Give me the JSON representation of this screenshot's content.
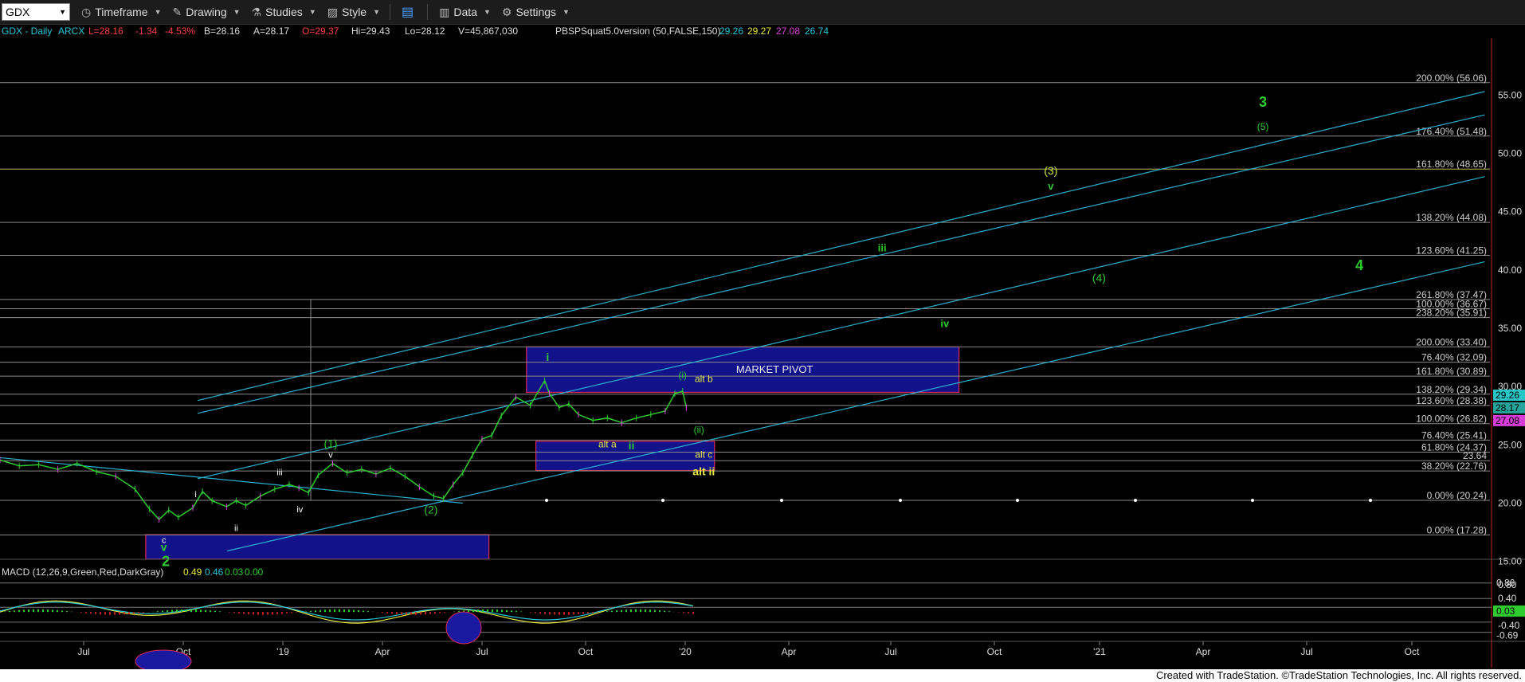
{
  "toolbar": {
    "symbol": "GDX",
    "items": [
      {
        "name": "timeframe",
        "label": "Timeframe",
        "icon": "clock-icon"
      },
      {
        "name": "drawing",
        "label": "Drawing",
        "icon": "pencil-icon"
      },
      {
        "name": "studies",
        "label": "Studies",
        "icon": "flask-icon"
      },
      {
        "name": "style",
        "label": "Style",
        "icon": "style-icon"
      },
      {
        "name": "data",
        "label": "Data",
        "icon": "bar-chart-icon"
      },
      {
        "name": "settings",
        "label": "Settings",
        "icon": "gear-icon"
      }
    ]
  },
  "header": {
    "symbol": "GDX - Daily",
    "exchange": "ARCX",
    "last": "L=28.16",
    "change": "-1.34",
    "pct": "-4.53%",
    "bid": "B=28.16",
    "ask": "A=28.17",
    "open": "O=29.37",
    "high": "Hi=29.43",
    "low": "Lo=28.12",
    "volume": "V=45,867,030",
    "study": "PBSPSquat5.0version (50,FALSE,150)",
    "study_values": [
      "29.26",
      "29.27",
      "27.08",
      "26.74"
    ]
  },
  "macd": {
    "label": "MACD (12,26,9,Green,Red,DarkGray)",
    "values": [
      "0.49",
      "0.46",
      "0.03",
      "0.00"
    ]
  },
  "footer": "Created with TradeStation. ©TradeStation Technologies, Inc. All rights reserved.",
  "chart_data": {
    "type": "candlestick",
    "symbol": "GDX",
    "interval": "Daily",
    "ylim": [
      14.5,
      57
    ],
    "price_ticks": [
      "15.00",
      "20.00",
      "25.00",
      "30.00",
      "35.00",
      "40.00",
      "45.00",
      "50.00",
      "55.00"
    ],
    "x_ticks": [
      "Jul",
      "Oct",
      "'19",
      "Apr",
      "Jul",
      "Oct",
      "'20",
      "Apr",
      "Jul",
      "Oct",
      "'21",
      "Apr",
      "Jul",
      "Oct"
    ],
    "close_series": [
      [
        0,
        23.7
      ],
      [
        20,
        23.2
      ],
      [
        40,
        23.3
      ],
      [
        60,
        22.9
      ],
      [
        80,
        23.4
      ],
      [
        100,
        22.7
      ],
      [
        120,
        22.3
      ],
      [
        140,
        21.2
      ],
      [
        155,
        19.5
      ],
      [
        165,
        18.6
      ],
      [
        175,
        19.4
      ],
      [
        185,
        18.8
      ],
      [
        200,
        19.6
      ],
      [
        210,
        21.0
      ],
      [
        220,
        20.2
      ],
      [
        235,
        19.7
      ],
      [
        245,
        20.2
      ],
      [
        255,
        19.8
      ],
      [
        270,
        20.6
      ],
      [
        285,
        21.2
      ],
      [
        300,
        21.6
      ],
      [
        310,
        21.3
      ],
      [
        320,
        20.9
      ],
      [
        330,
        22.4
      ],
      [
        345,
        23.4
      ],
      [
        360,
        22.6
      ],
      [
        375,
        22.9
      ],
      [
        390,
        22.5
      ],
      [
        405,
        23.0
      ],
      [
        420,
        22.3
      ],
      [
        435,
        21.4
      ],
      [
        450,
        20.6
      ],
      [
        460,
        20.4
      ],
      [
        470,
        21.6
      ],
      [
        480,
        22.6
      ],
      [
        490,
        24.1
      ],
      [
        500,
        25.5
      ],
      [
        510,
        25.8
      ],
      [
        520,
        27.5
      ],
      [
        535,
        29.1
      ],
      [
        550,
        28.4
      ],
      [
        565,
        30.5
      ],
      [
        570,
        29.4
      ],
      [
        580,
        28.2
      ],
      [
        590,
        28.5
      ],
      [
        600,
        27.6
      ],
      [
        615,
        27.1
      ],
      [
        630,
        27.3
      ],
      [
        645,
        26.9
      ],
      [
        660,
        27.3
      ],
      [
        675,
        27.6
      ],
      [
        690,
        27.9
      ],
      [
        700,
        29.4
      ],
      [
        708,
        29.6
      ],
      [
        712,
        28.2
      ]
    ],
    "key_levels": [
      {
        "label": "200.00% (56.06)",
        "value": 56.06
      },
      {
        "label": "176.40% (51.48)",
        "value": 51.48
      },
      {
        "label": "161.80% (48.65)",
        "value": 48.65
      },
      {
        "label": "138.20% (44.08)",
        "value": 44.08
      },
      {
        "label": "123.60% (41.25)",
        "value": 41.25
      },
      {
        "label": "261.80% (37.47)",
        "value": 37.47
      },
      {
        "label": "100.00% (36.67)",
        "value": 36.67
      },
      {
        "label": "238.20% (35.91)",
        "value": 35.91
      },
      {
        "label": "200.00% (33.40)",
        "value": 33.4
      },
      {
        "label": "76.40% (32.09)",
        "value": 32.09
      },
      {
        "label": "161.80% (30.89)",
        "value": 30.89
      },
      {
        "label": "138.20% (29.34)",
        "value": 29.34
      },
      {
        "label": "123.60% (28.38)",
        "value": 28.38
      },
      {
        "label": "100.00% (26.82)",
        "value": 26.82
      },
      {
        "label": "76.40% (25.41)",
        "value": 25.41
      },
      {
        "label": "61.80% (24.37)",
        "value": 24.37
      },
      {
        "label": "23.64",
        "value": 23.64
      },
      {
        "label": "38.20% (22.76)",
        "value": 22.76
      },
      {
        "label": "0.00% (20.24)",
        "value": 20.24
      },
      {
        "label": "0.00% (17.28)",
        "value": 17.28
      }
    ],
    "price_badges": [
      {
        "value": 29.26,
        "text": "29.26",
        "bg": "#26c6c6"
      },
      {
        "value": 28.17,
        "text": "28.17",
        "bg": "#26a69a"
      },
      {
        "value": 27.08,
        "text": "27.08",
        "bg": "#d63cd6"
      }
    ],
    "zones": [
      {
        "name": "market-pivot-zone",
        "label": "MARKET PIVOT",
        "x0": 560,
        "x1": 1020,
        "y0": 29.5,
        "y1": 33.4
      },
      {
        "name": "support-zone",
        "label": "",
        "x0": 570,
        "x1": 760,
        "y0": 22.8,
        "y1": 25.3
      },
      {
        "name": "low-zone",
        "label": "",
        "x0": 155,
        "x1": 520,
        "y0": 15.2,
        "y1": 17.3
      }
    ],
    "wave_labels": [
      {
        "text": "3",
        "x": 1310,
        "y": 54.0,
        "color": "#2ecc2e",
        "size": 18,
        "bold": true
      },
      {
        "text": "(5)",
        "x": 1310,
        "y": 52.0,
        "color": "#2ecc2e",
        "size": 12
      },
      {
        "text": "(3)",
        "x": 1090,
        "y": 48.2,
        "color": "#c8e63c",
        "size": 14
      },
      {
        "text": "v",
        "x": 1090,
        "y": 46.9,
        "color": "#2ecc2e",
        "size": 13,
        "bold": true
      },
      {
        "text": "iii",
        "x": 915,
        "y": 41.6,
        "color": "#2ecc2e",
        "size": 13,
        "bold": true
      },
      {
        "text": "(4)",
        "x": 1140,
        "y": 39.0,
        "color": "#2ecc2e",
        "size": 14
      },
      {
        "text": "4",
        "x": 1410,
        "y": 40.0,
        "color": "#2ecc2e",
        "size": 18,
        "bold": true
      },
      {
        "text": "iv",
        "x": 980,
        "y": 35.1,
        "color": "#2ecc2e",
        "size": 13,
        "bold": true
      },
      {
        "text": "i",
        "x": 568,
        "y": 32.2,
        "color": "#2ecc2e",
        "size": 14,
        "bold": true
      },
      {
        "text": "(i)",
        "x": 708,
        "y": 30.7,
        "color": "#2ecc2e",
        "size": 12
      },
      {
        "text": "alt b",
        "x": 730,
        "y": 30.4,
        "color": "#e8e83c",
        "size": 12
      },
      {
        "text": "(ii)",
        "x": 725,
        "y": 26.0,
        "color": "#2ecc2e",
        "size": 12
      },
      {
        "text": "alt a",
        "x": 630,
        "y": 24.8,
        "color": "#e8e83c",
        "size": 12
      },
      {
        "text": "ii",
        "x": 655,
        "y": 24.6,
        "color": "#2ecc2e",
        "size": 14,
        "bold": true
      },
      {
        "text": "alt c",
        "x": 730,
        "y": 23.9,
        "color": "#e8e83c",
        "size": 12
      },
      {
        "text": "alt ii",
        "x": 730,
        "y": 22.4,
        "color": "#e8e83c",
        "size": 14,
        "bold": true
      },
      {
        "text": "(1)",
        "x": 343,
        "y": 24.8,
        "color": "#2ecc2e",
        "size": 14
      },
      {
        "text": "v",
        "x": 343,
        "y": 23.9,
        "color": "#ffffff",
        "size": 11
      },
      {
        "text": "iii",
        "x": 290,
        "y": 22.4,
        "color": "#ffffff",
        "size": 11
      },
      {
        "text": "i",
        "x": 203,
        "y": 20.5,
        "color": "#ffffff",
        "size": 11
      },
      {
        "text": "iv",
        "x": 311,
        "y": 19.2,
        "color": "#ffffff",
        "size": 11
      },
      {
        "text": "ii",
        "x": 245,
        "y": 17.6,
        "color": "#ffffff",
        "size": 11
      },
      {
        "text": "(2)",
        "x": 447,
        "y": 19.1,
        "color": "#2ecc2e",
        "size": 14
      },
      {
        "text": "c",
        "x": 170,
        "y": 16.6,
        "color": "#ffffff",
        "size": 11
      },
      {
        "text": "v",
        "x": 170,
        "y": 15.9,
        "color": "#2ecc2e",
        "size": 14,
        "bold": true
      },
      {
        "text": "2",
        "x": 172,
        "y": 14.6,
        "color": "#2ecc2e",
        "size": 18,
        "bold": true
      }
    ],
    "channel_lines": [
      {
        "p0": [
          200,
          28.8
        ],
        "p1": [
          1540,
          55.3
        ]
      },
      {
        "p0": [
          200,
          27.7
        ],
        "p1": [
          1540,
          53.3
        ]
      },
      {
        "p0": [
          200,
          22.1
        ],
        "p1": [
          1540,
          48.0
        ]
      },
      {
        "p0": [
          230,
          15.9
        ],
        "p1": [
          1540,
          40.7
        ]
      },
      {
        "p0": [
          0,
          23.9
        ],
        "p1": [
          480,
          20.0
        ]
      }
    ],
    "macd_ticks": [
      "0.80",
      "0.40",
      "-0.40"
    ],
    "macd_badges": [
      {
        "text": "0.86",
        "value": 0.86
      },
      {
        "text": "0.03",
        "value": 0.03,
        "bg": "#2ecc2e"
      },
      {
        "text": "-0.69",
        "value": -0.69
      }
    ]
  }
}
